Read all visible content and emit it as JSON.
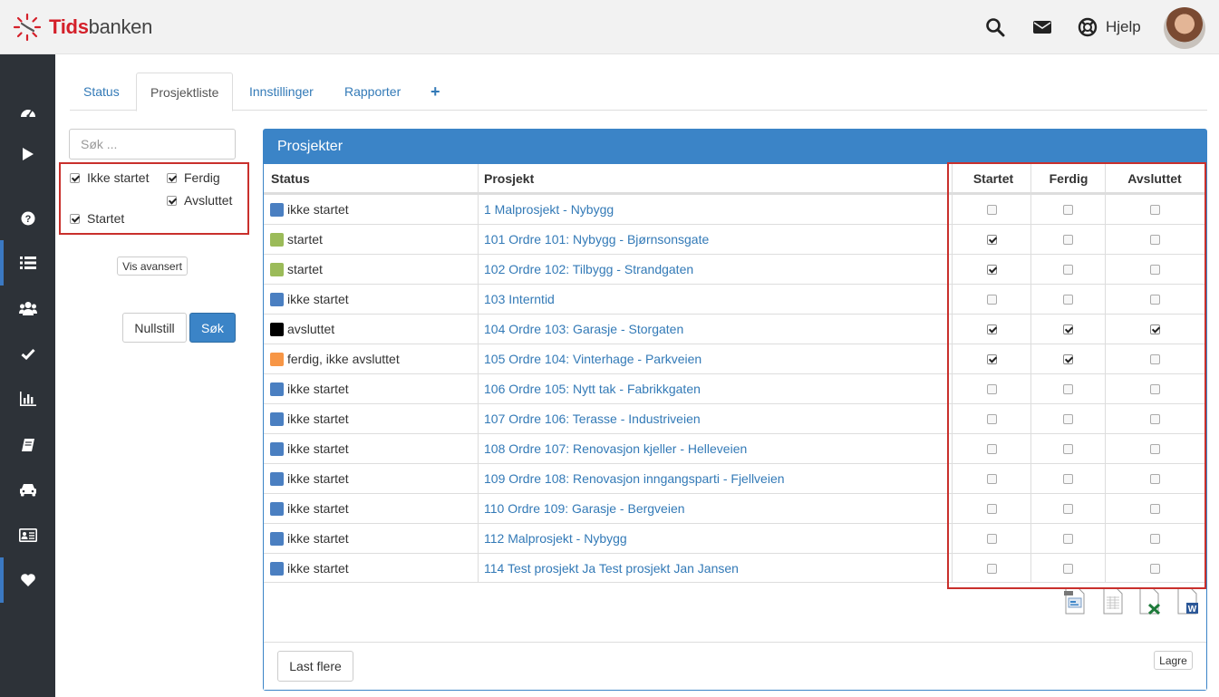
{
  "brand": {
    "part1": "Tids",
    "part2": "banken"
  },
  "header": {
    "help_label": "Hjelp"
  },
  "sidebar": {
    "items": [
      {
        "icon": "dashboard-icon"
      },
      {
        "icon": "play-icon"
      },
      {
        "icon": "help-icon"
      },
      {
        "icon": "list-icon"
      },
      {
        "icon": "users-icon"
      },
      {
        "icon": "check-icon"
      },
      {
        "icon": "bar-chart-icon"
      },
      {
        "icon": "book-icon"
      },
      {
        "icon": "car-icon"
      },
      {
        "icon": "id-card-icon"
      },
      {
        "icon": "heart-icon"
      }
    ]
  },
  "tabs": [
    {
      "label": "Status"
    },
    {
      "label": "Prosjektliste",
      "active": true
    },
    {
      "label": "Innstillinger"
    },
    {
      "label": "Rapporter"
    },
    {
      "label": "+"
    }
  ],
  "filters": {
    "search_placeholder": "Søk ...",
    "ikke_startet": "Ikke startet",
    "startet": "Startet",
    "ferdig": "Ferdig",
    "avsluttet": "Avsluttet",
    "vis_avansert": "Vis avansert",
    "nullstill": "Nullstill",
    "sok": "Søk"
  },
  "panel": {
    "title": "Prosjekter",
    "columns": {
      "status": "Status",
      "prosjekt": "Prosjekt",
      "startet": "Startet",
      "ferdig": "Ferdig",
      "avsluttet": "Avsluttet"
    },
    "rows": [
      {
        "status": "ikke startet",
        "color": "#4a7fc1",
        "project": "1 Malprosjekt - Nybygg",
        "startet": false,
        "ferdig": false,
        "avsluttet": false
      },
      {
        "status": "startet",
        "color": "#9bbb59",
        "project": "101 Ordre 101: Nybygg - Bjørnsonsgate",
        "startet": true,
        "ferdig": false,
        "avsluttet": false
      },
      {
        "status": "startet",
        "color": "#9bbb59",
        "project": "102 Ordre 102: Tilbygg - Strandgaten",
        "startet": true,
        "ferdig": false,
        "avsluttet": false
      },
      {
        "status": "ikke startet",
        "color": "#4a7fc1",
        "project": "103 Interntid",
        "startet": false,
        "ferdig": false,
        "avsluttet": false
      },
      {
        "status": "avsluttet",
        "color": "#000000",
        "project": "104 Ordre 103: Garasje - Storgaten",
        "startet": true,
        "ferdig": true,
        "avsluttet": true
      },
      {
        "status": "ferdig, ikke avsluttet",
        "color": "#f79646",
        "project": "105 Ordre 104: Vinterhage - Parkveien",
        "startet": true,
        "ferdig": true,
        "avsluttet": false
      },
      {
        "status": "ikke startet",
        "color": "#4a7fc1",
        "project": "106 Ordre 105: Nytt tak - Fabrikkgaten",
        "startet": false,
        "ferdig": false,
        "avsluttet": false
      },
      {
        "status": "ikke startet",
        "color": "#4a7fc1",
        "project": "107 Ordre 106: Terasse - Industriveien",
        "startet": false,
        "ferdig": false,
        "avsluttet": false
      },
      {
        "status": "ikke startet",
        "color": "#4a7fc1",
        "project": "108 Ordre 107: Renovasjon kjeller - Helleveien",
        "startet": false,
        "ferdig": false,
        "avsluttet": false
      },
      {
        "status": "ikke startet",
        "color": "#4a7fc1",
        "project": "109 Ordre 108: Renovasjon inngangsparti - Fjellveien",
        "startet": false,
        "ferdig": false,
        "avsluttet": false
      },
      {
        "status": "ikke startet",
        "color": "#4a7fc1",
        "project": "110 Ordre 109: Garasje - Bergveien",
        "startet": false,
        "ferdig": false,
        "avsluttet": false
      },
      {
        "status": "ikke startet",
        "color": "#4a7fc1",
        "project": "112 Malprosjekt - Nybygg",
        "startet": false,
        "ferdig": false,
        "avsluttet": false
      },
      {
        "status": "ikke startet",
        "color": "#4a7fc1",
        "project": "114 Test prosjekt Ja Test prosjekt Jan Jansen",
        "startet": false,
        "ferdig": false,
        "avsluttet": false
      }
    ],
    "export_icons": [
      "pdf-export-icon",
      "csv-export-icon",
      "excel-export-icon",
      "word-export-icon"
    ],
    "last_flere": "Last flere",
    "lagre": "Lagre"
  },
  "colors": {
    "accent": "#3b84c7",
    "sidebar": "#2d3238",
    "highlight": "#c9302c",
    "brand_red": "#d4202a"
  }
}
